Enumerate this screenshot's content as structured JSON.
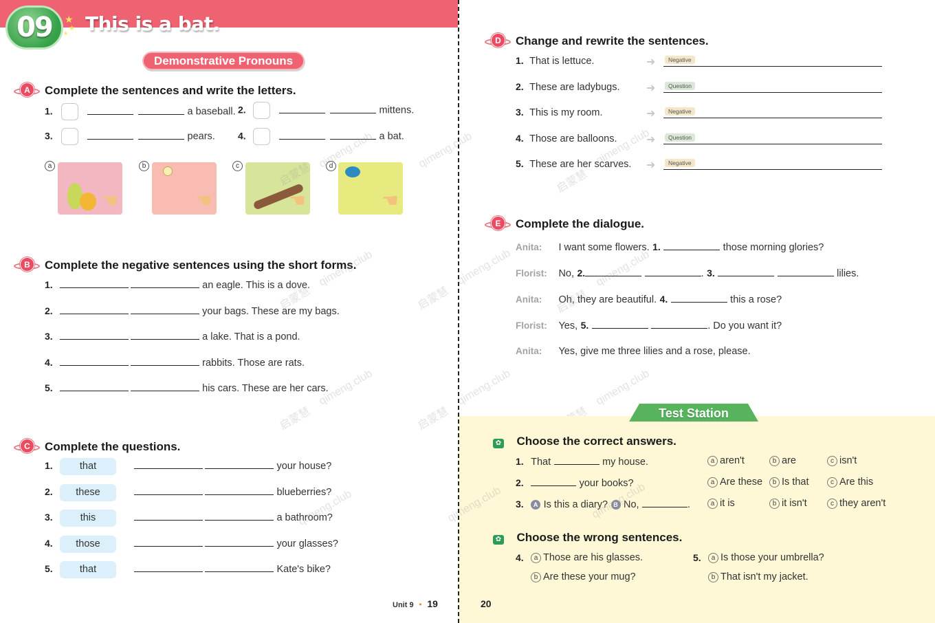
{
  "header": {
    "unit_number": "09",
    "title": "This is a bat.",
    "topic": "Demonstrative Pronouns"
  },
  "section_a": {
    "letter": "A",
    "title": "Complete the sentences and write the letters.",
    "items": [
      {
        "num": "1.",
        "text": "a baseball."
      },
      {
        "num": "2.",
        "text": "mittens."
      },
      {
        "num": "3.",
        "text": "pears."
      },
      {
        "num": "4.",
        "text": "a bat."
      }
    ],
    "pictures": [
      {
        "label": "a",
        "depicts": "pears",
        "bg": "#f2b7c0"
      },
      {
        "label": "b",
        "depicts": "baseball",
        "bg": "#f8bcb3"
      },
      {
        "label": "c",
        "depicts": "bat",
        "bg": "#d6e59a"
      },
      {
        "label": "d",
        "depicts": "mittens",
        "bg": "#e7ea7f"
      }
    ]
  },
  "section_b": {
    "letter": "B",
    "title": "Complete the negative sentences using the short forms.",
    "items": [
      {
        "num": "1.",
        "text": "an eagle. This is a dove."
      },
      {
        "num": "2.",
        "text": "your bags. These are my bags."
      },
      {
        "num": "3.",
        "text": "a lake. That is a pond."
      },
      {
        "num": "4.",
        "text": "rabbits. Those are rats."
      },
      {
        "num": "5.",
        "text": "his cars. These are her cars."
      }
    ]
  },
  "section_c": {
    "letter": "C",
    "title": "Complete the questions.",
    "items": [
      {
        "num": "1.",
        "word": "that",
        "text": "your house?"
      },
      {
        "num": "2.",
        "word": "these",
        "text": "blueberries?"
      },
      {
        "num": "3.",
        "word": "this",
        "text": "a bathroom?"
      },
      {
        "num": "4.",
        "word": "those",
        "text": "your glasses?"
      },
      {
        "num": "5.",
        "word": "that",
        "text": "Kate's bike?"
      }
    ]
  },
  "section_d": {
    "letter": "D",
    "title": "Change and rewrite the sentences.",
    "items": [
      {
        "num": "1.",
        "text": "That is lettuce.",
        "tag": "Negative"
      },
      {
        "num": "2.",
        "text": "These are ladybugs.",
        "tag": "Question"
      },
      {
        "num": "3.",
        "text": "This is my room.",
        "tag": "Negative"
      },
      {
        "num": "4.",
        "text": "Those are balloons.",
        "tag": "Question"
      },
      {
        "num": "5.",
        "text": "These are her scarves.",
        "tag": "Negative"
      }
    ]
  },
  "section_e": {
    "letter": "E",
    "title": "Complete the dialogue.",
    "lines": [
      {
        "speaker": "Anita:",
        "pre": "I want some flowers.",
        "n1": "1.",
        "post": "those morning glories?"
      },
      {
        "speaker": "Florist:",
        "pre": "No,",
        "n1": "2.",
        "mid": ".",
        "n2": "3.",
        "post": "lilies."
      },
      {
        "speaker": "Anita:",
        "pre": "Oh, they are beautiful.",
        "n1": "4.",
        "post": "this a rose?"
      },
      {
        "speaker": "Florist:",
        "pre": "Yes,",
        "n1": "5.",
        "post": ". Do you want it?"
      },
      {
        "speaker": "Anita:",
        "pre": "Yes, give me three lilies and a rose, please."
      }
    ]
  },
  "test_station": {
    "banner": "Test Station",
    "part1": {
      "title": "Choose the correct answers.",
      "items": [
        {
          "num": "1.",
          "pre": "That",
          "post": "my house.",
          "options": [
            {
              "l": "a",
              "t": "aren't"
            },
            {
              "l": "b",
              "t": "are"
            },
            {
              "l": "c",
              "t": "isn't"
            }
          ]
        },
        {
          "num": "2.",
          "pre": "",
          "post": "your books?",
          "options": [
            {
              "l": "a",
              "t": "Are these"
            },
            {
              "l": "b",
              "t": "Is that"
            },
            {
              "l": "c",
              "t": "Are this"
            }
          ]
        },
        {
          "num": "3.",
          "speaker_a": "A",
          "q": "Is this a diary?",
          "speaker_b": "B",
          "ans": "No,",
          "post": ".",
          "options": [
            {
              "l": "a",
              "t": "it is"
            },
            {
              "l": "b",
              "t": "it isn't"
            },
            {
              "l": "c",
              "t": "they aren't"
            }
          ]
        }
      ]
    },
    "part2": {
      "title": "Choose the wrong sentences.",
      "items": [
        {
          "num": "4.",
          "options": [
            {
              "l": "a",
              "t": "Those are his glasses."
            },
            {
              "l": "b",
              "t": "Are these your mug?"
            }
          ]
        },
        {
          "num": "5.",
          "options": [
            {
              "l": "a",
              "t": "Is those your umbrella?"
            },
            {
              "l": "b",
              "t": "That isn't my jacket."
            }
          ]
        }
      ]
    }
  },
  "footer": {
    "left_unit": "Unit 9",
    "left_page": "19",
    "right_page": "20"
  },
  "watermark": {
    "text_cn": "启蒙慧",
    "text_en": "qimeng.club"
  },
  "colors": {
    "brand_pink": "#ef6272",
    "brand_green": "#57b45d",
    "test_station_bg": "#fef8d6",
    "chip_blue": "#dcf0fb"
  }
}
